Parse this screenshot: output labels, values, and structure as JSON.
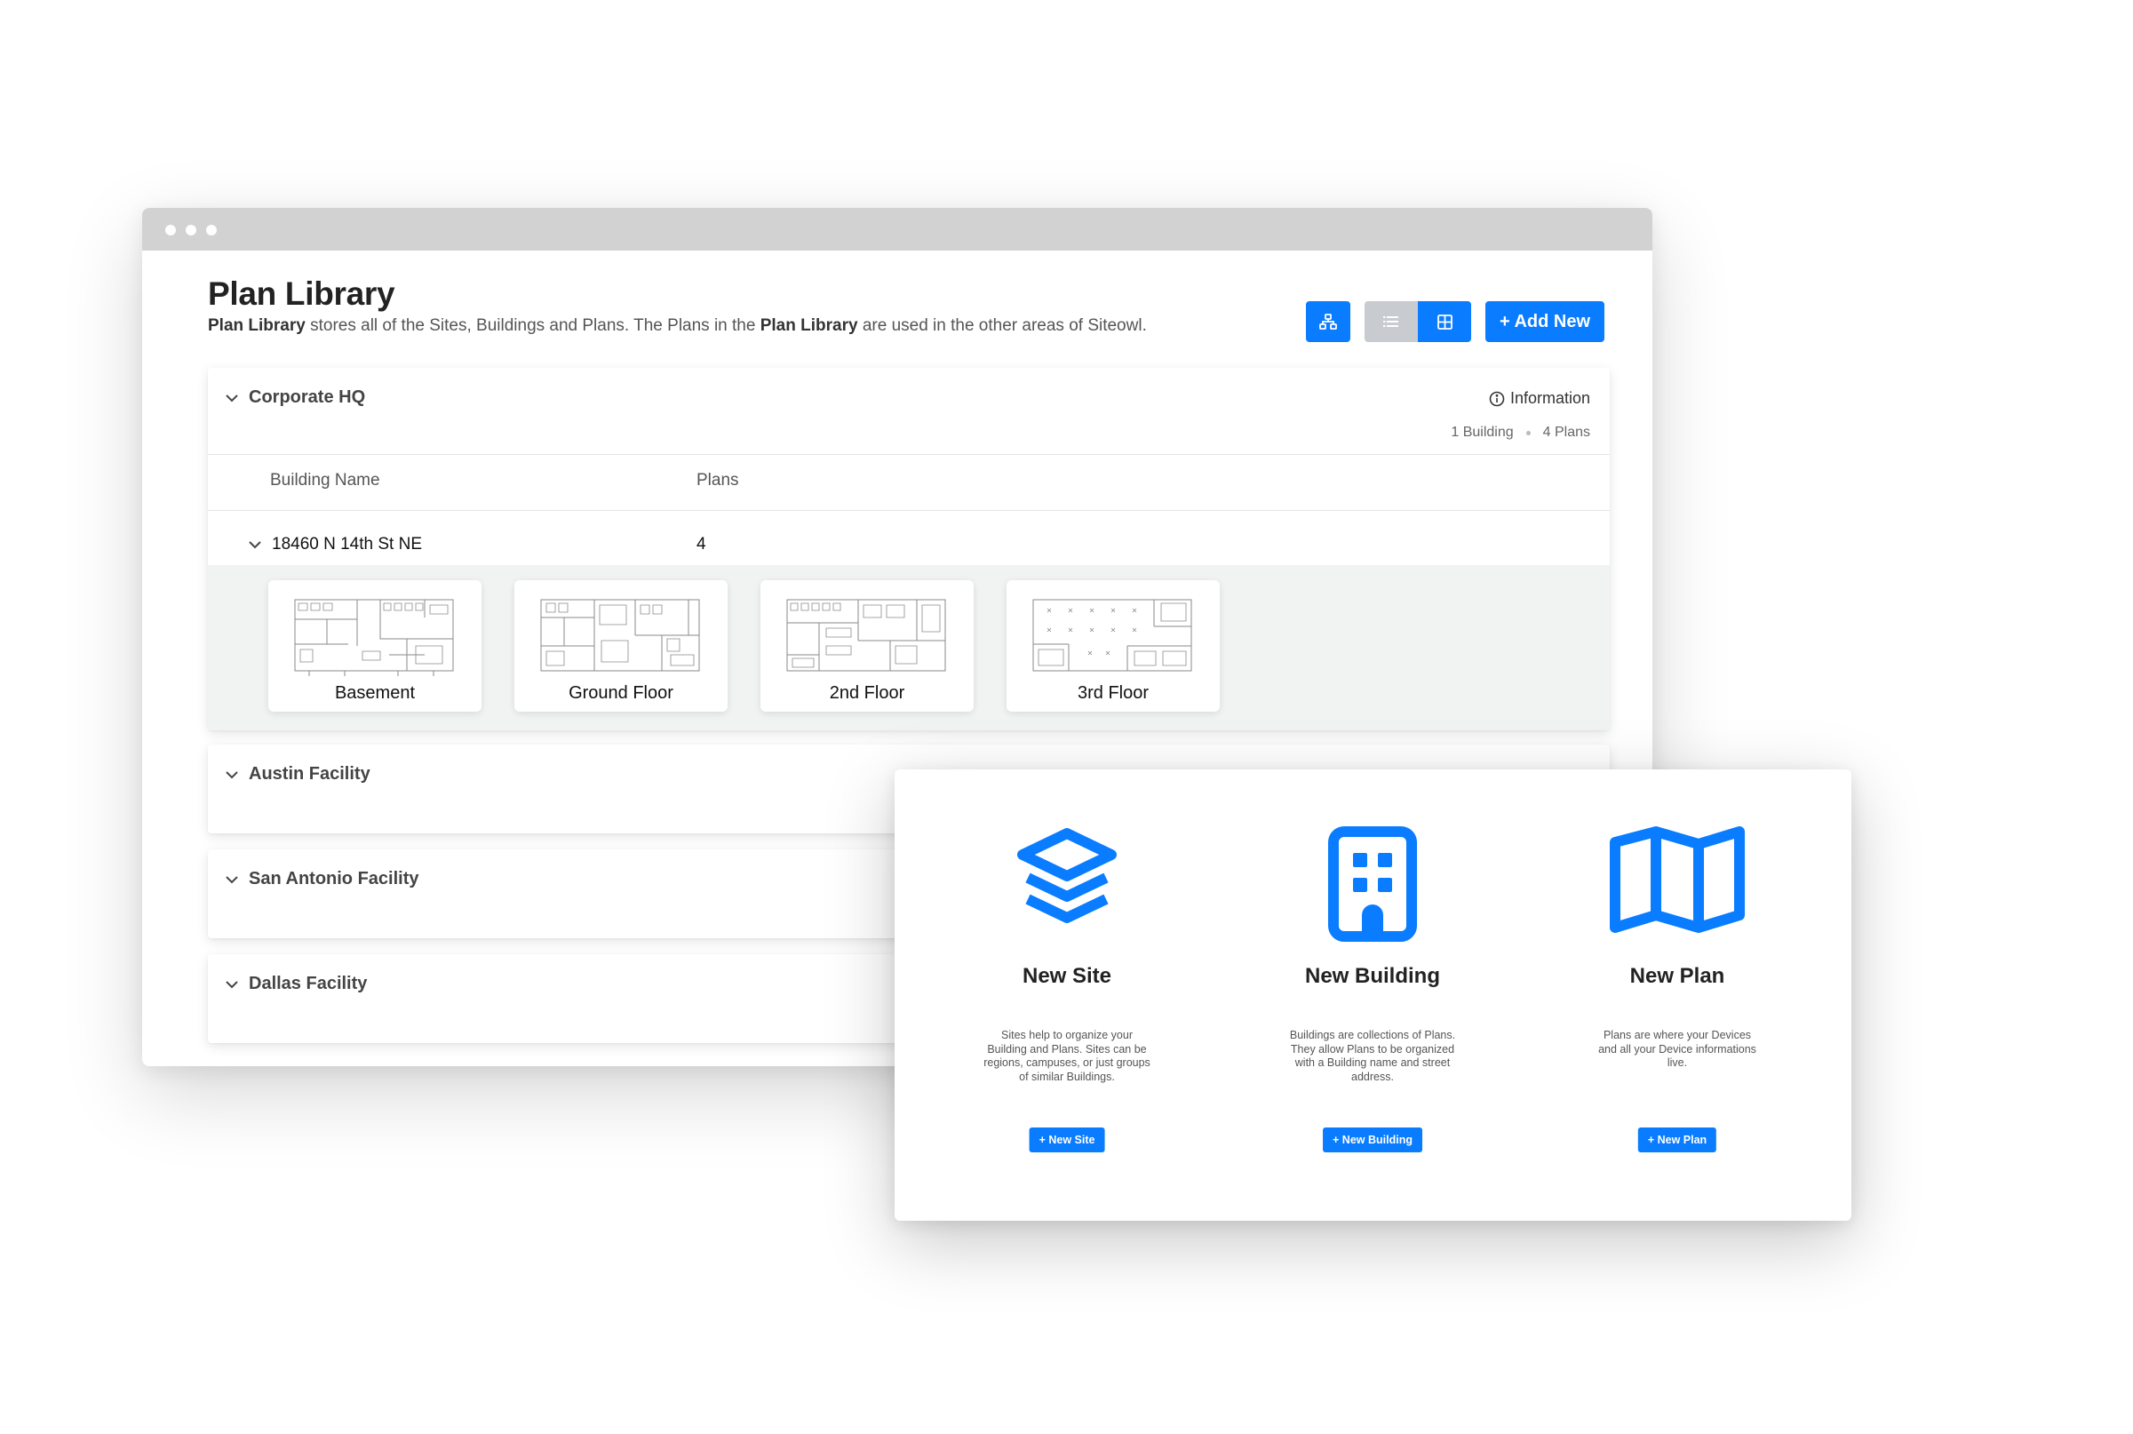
{
  "page": {
    "title": "Plan Library",
    "description_parts": [
      "Plan Library",
      " stores all of the Sites, Buildings and Plans. The Plans in the ",
      "Plan Library",
      " are used in the other areas of Siteowl."
    ]
  },
  "toolbar": {
    "hierarchy_icon": "sitemap-icon",
    "list_icon": "list-icon",
    "grid_icon": "grid-icon",
    "add_label": "+ Add New",
    "active_view": "grid"
  },
  "sites": [
    {
      "name": "Corporate HQ",
      "expanded": true,
      "info_label": "Information",
      "stats": {
        "buildings": "1 Building",
        "plans": "4 Plans"
      },
      "columns": {
        "building": "Building Name",
        "plans": "Plans"
      },
      "building": {
        "name": "18460 N 14th St NE",
        "plan_count": "4"
      },
      "plans": [
        {
          "label": "Basement"
        },
        {
          "label": "Ground Floor"
        },
        {
          "label": "2nd Floor"
        },
        {
          "label": "3rd Floor"
        }
      ]
    },
    {
      "name": "Austin Facility",
      "expanded": false
    },
    {
      "name": "San Antonio Facility",
      "expanded": false
    },
    {
      "name": "Dallas Facility",
      "expanded": false
    }
  ],
  "new_options": [
    {
      "icon": "layers-icon",
      "title": "New Site",
      "description": "Sites help to organize your Building and Plans. Sites can be regions, campuses, or just groups of similar Buildings.",
      "button": "+ New Site"
    },
    {
      "icon": "building-icon",
      "title": "New Building",
      "description": "Buildings are collections of Plans. They allow Plans to be organized with a Building name and street address.",
      "button": "+ New Building"
    },
    {
      "icon": "map-icon",
      "title": "New Plan",
      "description": "Plans are where your Devices and all your Device informations live.",
      "button": "+ New Plan"
    }
  ],
  "colors": {
    "accent": "#0a7cff",
    "toggle_inactive": "#c8cbd0",
    "plans_bg": "#f1f3f2"
  }
}
